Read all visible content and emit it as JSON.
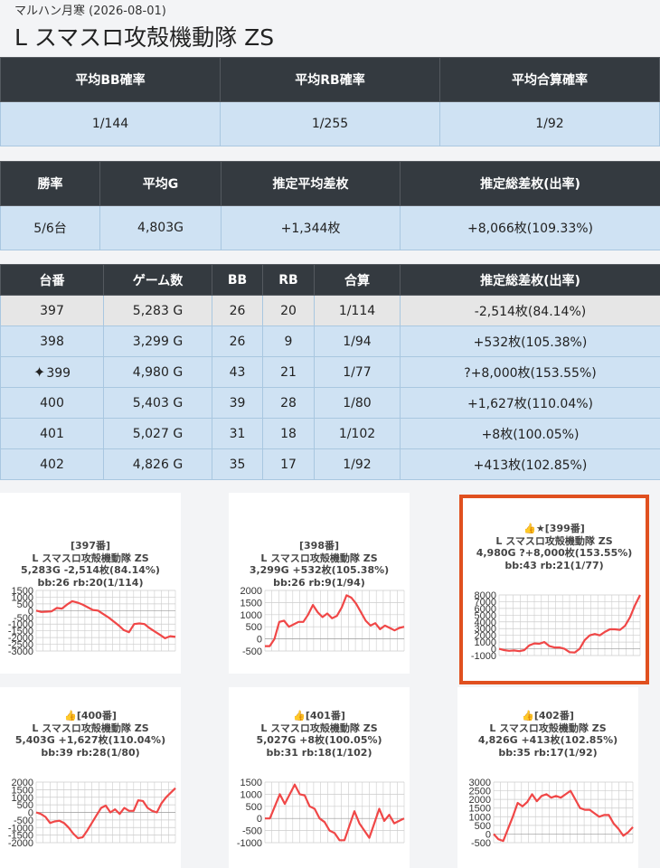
{
  "header": {
    "subtitle": "マルハン月寒 (2026-08-01)",
    "title": "L スマスロ攻殻機動隊 ZS"
  },
  "summary1": {
    "headers": [
      "平均BB確率",
      "平均RB確率",
      "平均合算確率"
    ],
    "values": [
      "1/144",
      "1/255",
      "1/92"
    ]
  },
  "summary2": {
    "headers": [
      "勝率",
      "平均G",
      "推定平均差枚",
      "推定総差枚(出率)"
    ],
    "values": [
      "5/6台",
      "4,803G",
      "+1,344枚",
      "+8,066枚(109.33%)"
    ]
  },
  "machines": {
    "headers": [
      "台番",
      "ゲーム数",
      "BB",
      "RB",
      "合算",
      "推定総差枚(出率)"
    ],
    "rows": [
      {
        "no": "397",
        "games": "5,283 G",
        "bb": "26",
        "rb": "20",
        "total": "1/114",
        "diff": "-2,514枚(84.14%)",
        "sparkle": ""
      },
      {
        "no": "398",
        "games": "3,299 G",
        "bb": "26",
        "rb": "9",
        "total": "1/94",
        "diff": "+532枚(105.38%)",
        "sparkle": ""
      },
      {
        "no": "399",
        "games": "4,980 G",
        "bb": "43",
        "rb": "21",
        "total": "1/77",
        "diff": "?+8,000枚(153.55%)",
        "sparkle": "✦"
      },
      {
        "no": "400",
        "games": "5,403 G",
        "bb": "39",
        "rb": "28",
        "total": "1/80",
        "diff": "+1,627枚(110.04%)",
        "sparkle": ""
      },
      {
        "no": "401",
        "games": "5,027 G",
        "bb": "31",
        "rb": "18",
        "total": "1/102",
        "diff": "+8枚(100.05%)",
        "sparkle": ""
      },
      {
        "no": "402",
        "games": "4,826 G",
        "bb": "35",
        "rb": "17",
        "total": "1/92",
        "diff": "+413枚(102.85%)",
        "sparkle": ""
      }
    ]
  },
  "colors": {
    "line": "#f04747",
    "grid": "#cccccc",
    "highlight": "#e0501f",
    "header_bg": "#343a40",
    "cell_bg": "#cfe2f3"
  },
  "charts": [
    {
      "line1": "[397番]",
      "line2": "L スマスロ攻殻機動隊 ZS",
      "line3": "5,283G -2,514枚(84.14%)",
      "line4": "bb:26 rb:20(1/114)",
      "chart_data": {
        "type": "line",
        "ylim": [
          -3000,
          1500
        ],
        "yticks": [
          1500,
          1000,
          500,
          0,
          -500,
          -1000,
          -1500,
          -2000,
          -2500,
          -3000
        ],
        "y": [
          0,
          -100,
          -80,
          -50,
          200,
          150,
          450,
          700,
          600,
          450,
          250,
          50,
          0,
          -250,
          -500,
          -800,
          -1100,
          -1450,
          -1600,
          -1000,
          -950,
          -1000,
          -1300,
          -1550,
          -1800,
          -2050,
          -1900,
          -1950
        ]
      }
    },
    {
      "line1": "[398番]",
      "line2": "L スマスロ攻殻機動隊 ZS",
      "line3": "3,299G +532枚(105.38%)",
      "line4": "bb:26 rb:9(1/94)",
      "chart_data": {
        "type": "line",
        "ylim": [
          -500,
          2000
        ],
        "yticks": [
          2000,
          1500,
          1000,
          500,
          0,
          -500
        ],
        "y": [
          -300,
          -300,
          0,
          700,
          750,
          500,
          600,
          700,
          700,
          1000,
          1400,
          1100,
          900,
          1050,
          850,
          950,
          1300,
          1800,
          1700,
          1450,
          1100,
          750,
          550,
          650,
          400,
          550,
          450,
          350,
          450,
          500
        ]
      }
    },
    {
      "line1": "👍★[399番]",
      "line2": "L スマスロ攻殻機動隊 ZS",
      "line3": "4,980G ?+8,000枚(153.55%)",
      "line4": "bb:43 rb:21(1/77)",
      "chart_data": {
        "type": "line",
        "ylim": [
          -1000,
          8000
        ],
        "yticks": [
          8000,
          7000,
          6000,
          5000,
          4000,
          3000,
          2000,
          1000,
          0,
          -1000
        ],
        "y": [
          0,
          -200,
          -300,
          -250,
          -350,
          -200,
          500,
          800,
          750,
          1000,
          400,
          200,
          200,
          0,
          -500,
          -550,
          0,
          1300,
          2000,
          2200,
          2000,
          2500,
          2900,
          2900,
          2800,
          3400,
          4700,
          6500,
          8000
        ]
      }
    },
    {
      "line1": "👍[400番]",
      "line2": "L スマスロ攻殻機動隊 ZS",
      "line3": "5,403G +1,627枚(110.04%)",
      "line4": "bb:39 rb:28(1/80)",
      "chart_data": {
        "type": "line",
        "ylim": [
          -2000,
          2000
        ],
        "yticks": [
          2000,
          1500,
          1000,
          500,
          0,
          -500,
          -1000,
          -1500,
          -2000
        ],
        "y": [
          0,
          -100,
          -300,
          -700,
          -600,
          -550,
          -700,
          -1000,
          -1400,
          -1700,
          -1650,
          -1200,
          -700,
          -200,
          300,
          450,
          0,
          200,
          -100,
          300,
          100,
          100,
          800,
          750,
          300,
          100,
          0,
          600,
          1000,
          1300,
          1600
        ]
      }
    },
    {
      "line1": "👍[401番]",
      "line2": "L スマスロ攻殻機動隊 ZS",
      "line3": "5,027G +8枚(100.05%)",
      "line4": "bb:31 rb:18(1/102)",
      "chart_data": {
        "type": "line",
        "ylim": [
          -1000,
          1500
        ],
        "yticks": [
          1500,
          1000,
          500,
          0,
          -500,
          -1000
        ],
        "y": [
          0,
          0,
          500,
          1000,
          600,
          1000,
          1400,
          1000,
          950,
          500,
          400,
          0,
          -150,
          -500,
          -600,
          -900,
          -900,
          -300,
          300,
          -200,
          -500,
          -800,
          -200,
          400,
          -100,
          150,
          -200,
          -100,
          0
        ]
      }
    },
    {
      "line1": "👍[402番]",
      "line2": "L スマスロ攻殻機動隊 ZS",
      "line3": "4,826G +413枚(102.85%)",
      "line4": "bb:35 rb:17(1/92)",
      "chart_data": {
        "type": "line",
        "ylim": [
          -500,
          3000
        ],
        "yticks": [
          3000,
          2500,
          2000,
          1500,
          1000,
          500,
          0,
          -500
        ],
        "y": [
          0,
          -300,
          -400,
          300,
          1000,
          1800,
          1600,
          1850,
          2300,
          1900,
          2200,
          2300,
          2100,
          2200,
          2100,
          2300,
          2500,
          2000,
          1500,
          1400,
          1400,
          1200,
          1000,
          1100,
          1100,
          600,
          300,
          -100,
          100,
          400
        ]
      }
    }
  ]
}
